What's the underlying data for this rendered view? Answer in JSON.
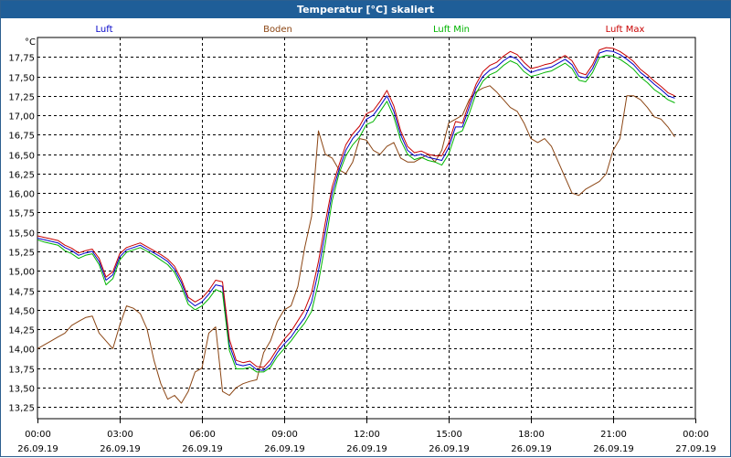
{
  "window": {
    "title": "Temperatur [°C] skaliert"
  },
  "chart_data": {
    "type": "line",
    "title": "Temperatur [°C] skaliert",
    "ylabel": "°C",
    "ylim": [
      13.1,
      18.0
    ],
    "xlim_hours": [
      0,
      24
    ],
    "grid": true,
    "legend_position": "top",
    "y_ticks": [
      "13,25",
      "13,50",
      "13,75",
      "14,00",
      "14,25",
      "14,50",
      "14,75",
      "15,00",
      "15,25",
      "15,50",
      "15,75",
      "16,00",
      "16,25",
      "16,50",
      "16,75",
      "17,00",
      "17,25",
      "17,50",
      "17,75"
    ],
    "y_tick_values": [
      13.25,
      13.5,
      13.75,
      14.0,
      14.25,
      14.5,
      14.75,
      15.0,
      15.25,
      15.5,
      15.75,
      16.0,
      16.25,
      16.5,
      16.75,
      17.0,
      17.25,
      17.5,
      17.75
    ],
    "x_ticks": [
      {
        "time": "00:00",
        "date": "26.09.19"
      },
      {
        "time": "03:00",
        "date": "26.09.19"
      },
      {
        "time": "06:00",
        "date": "26.09.19"
      },
      {
        "time": "09:00",
        "date": "26.09.19"
      },
      {
        "time": "12:00",
        "date": "26.09.19"
      },
      {
        "time": "15:00",
        "date": "26.09.19"
      },
      {
        "time": "18:00",
        "date": "26.09.19"
      },
      {
        "time": "21:00",
        "date": "26.09.19"
      },
      {
        "time": "00:00",
        "date": "27.09.19"
      }
    ],
    "x": [
      0,
      0.25,
      0.5,
      0.75,
      1.0,
      1.25,
      1.5,
      1.75,
      2.0,
      2.25,
      2.5,
      2.75,
      3.0,
      3.25,
      3.5,
      3.75,
      4.0,
      4.25,
      4.5,
      4.75,
      5.0,
      5.25,
      5.5,
      5.75,
      6.0,
      6.25,
      6.5,
      6.75,
      7.0,
      7.25,
      7.5,
      7.75,
      8.0,
      8.25,
      8.5,
      8.75,
      9.0,
      9.25,
      9.5,
      9.75,
      10.0,
      10.25,
      10.5,
      10.75,
      11.0,
      11.25,
      11.5,
      11.75,
      12.0,
      12.25,
      12.5,
      12.75,
      13.0,
      13.25,
      13.5,
      13.75,
      14.0,
      14.25,
      14.5,
      14.75,
      15.0,
      15.25,
      15.5,
      15.75,
      16.0,
      16.25,
      16.5,
      16.75,
      17.0,
      17.25,
      17.5,
      17.75,
      18.0,
      18.25,
      18.5,
      18.75,
      19.0,
      19.25,
      19.5,
      19.75,
      20.0,
      20.25,
      20.5,
      20.75,
      21.0,
      21.25,
      21.5,
      21.75,
      22.0,
      22.25,
      22.5,
      22.75,
      23.0,
      23.25,
      23.5,
      23.75,
      24.0
    ],
    "series": [
      {
        "name": "Luft",
        "color": "#0000c8",
        "values": [
          15.42,
          15.4,
          15.38,
          15.36,
          15.3,
          15.26,
          15.2,
          15.23,
          15.25,
          15.12,
          14.88,
          14.95,
          15.18,
          15.27,
          15.3,
          15.33,
          15.28,
          15.23,
          15.18,
          15.12,
          15.02,
          14.85,
          14.62,
          14.55,
          14.6,
          14.7,
          14.82,
          14.8,
          14.05,
          13.8,
          13.78,
          13.8,
          13.73,
          13.72,
          13.8,
          13.95,
          14.06,
          14.15,
          14.28,
          14.4,
          14.6,
          15.0,
          15.5,
          16.0,
          16.3,
          16.55,
          16.7,
          16.8,
          16.95,
          17.0,
          17.12,
          17.25,
          17.05,
          16.75,
          16.55,
          16.48,
          16.5,
          16.46,
          16.44,
          16.42,
          16.58,
          16.85,
          16.85,
          17.1,
          17.35,
          17.5,
          17.58,
          17.62,
          17.7,
          17.76,
          17.72,
          17.62,
          17.55,
          17.58,
          17.6,
          17.62,
          17.67,
          17.72,
          17.65,
          17.5,
          17.48,
          17.6,
          17.8,
          17.83,
          17.82,
          17.78,
          17.72,
          17.65,
          17.55,
          17.48,
          17.4,
          17.33,
          17.25,
          17.22
        ]
      },
      {
        "name": "Boden",
        "color": "#8b4513",
        "values": [
          14.0,
          14.05,
          14.1,
          14.15,
          14.2,
          14.3,
          14.35,
          14.4,
          14.42,
          14.2,
          14.1,
          14.0,
          14.3,
          14.55,
          14.52,
          14.45,
          14.25,
          13.85,
          13.55,
          13.35,
          13.4,
          13.3,
          13.45,
          13.7,
          13.75,
          14.2,
          14.28,
          13.45,
          13.4,
          13.5,
          13.55,
          13.58,
          13.6,
          13.95,
          14.1,
          14.35,
          14.5,
          14.55,
          14.8,
          15.3,
          15.7,
          16.8,
          16.5,
          16.45,
          16.3,
          16.25,
          16.4,
          16.7,
          16.68,
          16.55,
          16.5,
          16.6,
          16.65,
          16.45,
          16.4,
          16.4,
          16.45,
          16.5,
          16.4,
          16.55,
          16.9,
          16.95,
          17.0,
          17.2,
          17.3,
          17.35,
          17.38,
          17.3,
          17.2,
          17.1,
          17.05,
          16.9,
          16.7,
          16.65,
          16.7,
          16.6,
          16.4,
          16.2,
          16.0,
          15.97,
          16.05,
          16.1,
          16.15,
          16.25,
          16.55,
          16.7,
          17.25,
          17.25,
          17.2,
          17.1,
          16.98,
          16.95,
          16.85,
          16.72
        ]
      },
      {
        "name": "Luft Min",
        "color": "#00b400",
        "values": [
          15.4,
          15.37,
          15.35,
          15.33,
          15.26,
          15.22,
          15.16,
          15.2,
          15.22,
          15.08,
          14.82,
          14.9,
          15.14,
          15.24,
          15.27,
          15.3,
          15.25,
          15.2,
          15.14,
          15.08,
          14.98,
          14.8,
          14.57,
          14.5,
          14.55,
          14.64,
          14.76,
          14.72,
          13.98,
          13.74,
          13.74,
          13.76,
          13.7,
          13.7,
          13.76,
          13.9,
          14.0,
          14.1,
          14.22,
          14.33,
          14.48,
          14.85,
          15.35,
          15.9,
          16.25,
          16.48,
          16.62,
          16.72,
          16.88,
          16.92,
          17.05,
          17.18,
          16.98,
          16.68,
          16.5,
          16.43,
          16.46,
          16.42,
          16.4,
          16.36,
          16.5,
          16.76,
          16.8,
          17.02,
          17.28,
          17.44,
          17.52,
          17.56,
          17.64,
          17.7,
          17.66,
          17.56,
          17.5,
          17.52,
          17.55,
          17.57,
          17.62,
          17.67,
          17.6,
          17.45,
          17.43,
          17.55,
          17.74,
          17.77,
          17.76,
          17.72,
          17.66,
          17.59,
          17.49,
          17.42,
          17.33,
          17.27,
          17.2,
          17.16
        ]
      },
      {
        "name": "Luft Max",
        "color": "#c80000",
        "values": [
          15.45,
          15.43,
          15.41,
          15.39,
          15.33,
          15.29,
          15.23,
          15.26,
          15.28,
          15.16,
          14.92,
          14.99,
          15.22,
          15.3,
          15.33,
          15.36,
          15.31,
          15.26,
          15.21,
          15.15,
          15.06,
          14.89,
          14.66,
          14.6,
          14.65,
          14.75,
          14.88,
          14.86,
          14.12,
          13.85,
          13.82,
          13.84,
          13.77,
          13.76,
          13.86,
          14.0,
          14.12,
          14.22,
          14.36,
          14.5,
          14.72,
          15.12,
          15.62,
          16.08,
          16.36,
          16.62,
          16.76,
          16.86,
          17.02,
          17.06,
          17.18,
          17.32,
          17.12,
          16.8,
          16.6,
          16.52,
          16.54,
          16.5,
          16.48,
          16.48,
          16.64,
          16.92,
          16.9,
          17.16,
          17.4,
          17.56,
          17.64,
          17.68,
          17.76,
          17.82,
          17.78,
          17.68,
          17.6,
          17.62,
          17.65,
          17.67,
          17.72,
          17.77,
          17.7,
          17.55,
          17.52,
          17.65,
          17.84,
          17.87,
          17.86,
          17.82,
          17.76,
          17.69,
          17.59,
          17.52,
          17.44,
          17.37,
          17.29,
          17.25
        ]
      }
    ]
  }
}
